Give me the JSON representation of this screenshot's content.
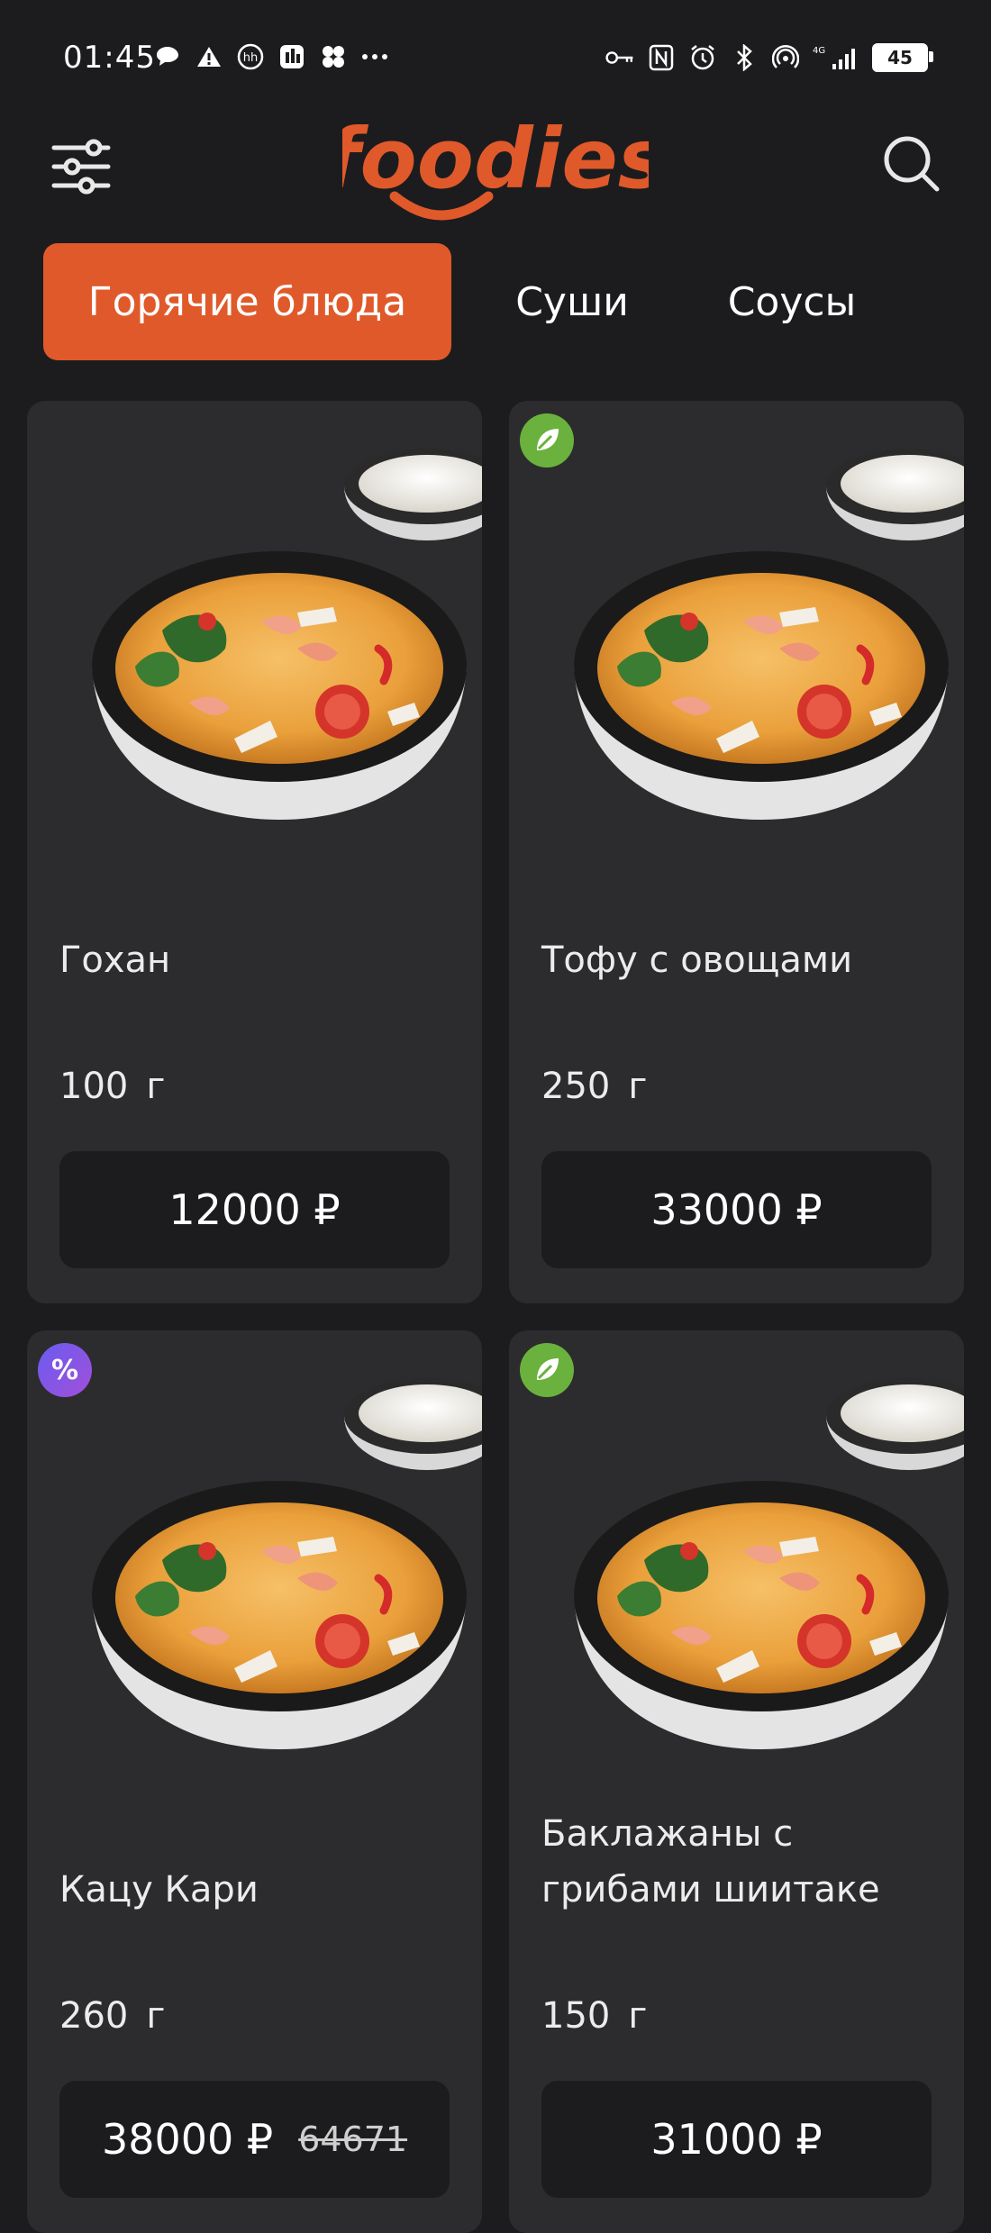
{
  "status_bar": {
    "time": "01:45",
    "network": "4G",
    "battery": "45"
  },
  "header": {
    "logo_text": "foodies",
    "brand_color": "#e0592a"
  },
  "tabs": [
    {
      "label": "Горячие блюда",
      "active": true
    },
    {
      "label": "Суши",
      "active": false
    },
    {
      "label": "Соусы",
      "active": false
    }
  ],
  "products": [
    {
      "name": "Гохан",
      "weight": "100",
      "unit": "г",
      "price": "12000 ₽",
      "old_price": "",
      "badge": ""
    },
    {
      "name": "Тофу с овощами",
      "weight": "250",
      "unit": "г",
      "price": "33000 ₽",
      "old_price": "",
      "badge": "leaf-icon"
    },
    {
      "name": "Кацу Кари",
      "weight": "260",
      "unit": "г",
      "price": "38000 ₽",
      "old_price": "64671",
      "badge": "percent-icon"
    },
    {
      "name": "Баклажаны с грибами шиитаке",
      "weight": "150",
      "unit": "г",
      "price": "31000 ₽",
      "old_price": "",
      "badge": "leaf-icon"
    }
  ]
}
